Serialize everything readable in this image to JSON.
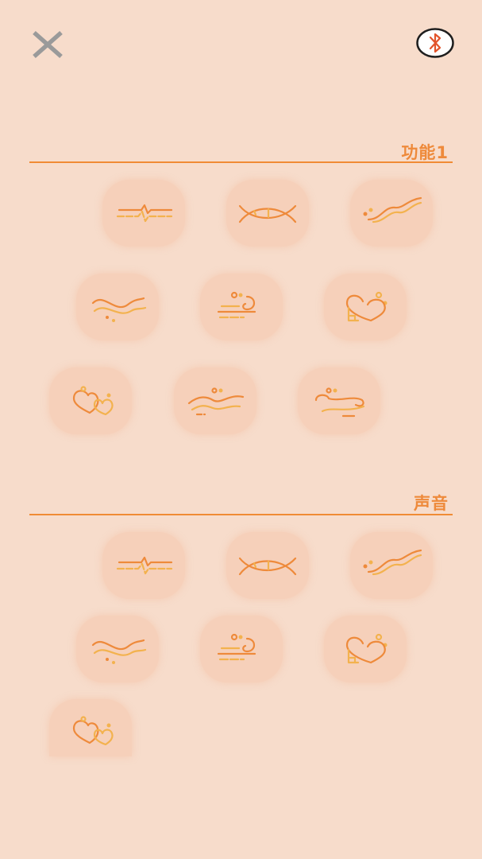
{
  "header": {
    "close_icon": "close-x-icon",
    "bluetooth_icon": "bluetooth-icon",
    "close_color": "#9a9a9a",
    "bluetooth_color": "#e2542b"
  },
  "sections": [
    {
      "title": "功能1",
      "modes": [
        {
          "icon": "pulse-line-icon"
        },
        {
          "icon": "crossed-waves-icon"
        },
        {
          "icon": "double-wave-icon"
        },
        {
          "icon": "ripple-waves-icon"
        },
        {
          "icon": "wind-swirl-icon"
        },
        {
          "icon": "cloud-heart-icon"
        },
        {
          "icon": "double-heart-icon"
        },
        {
          "icon": "mountain-waves-icon"
        },
        {
          "icon": "cloud-stream-icon"
        }
      ]
    },
    {
      "title": "声音",
      "modes": [
        {
          "icon": "pulse-line-icon"
        },
        {
          "icon": "crossed-waves-icon"
        },
        {
          "icon": "double-wave-icon"
        },
        {
          "icon": "ripple-waves-icon"
        },
        {
          "icon": "wind-swirl-icon"
        },
        {
          "icon": "cloud-heart-icon"
        },
        {
          "icon": "double-heart-icon"
        }
      ]
    }
  ],
  "colors": {
    "background": "#f7dccb",
    "accent": "#ee8a3b",
    "accent_light": "#f3b24e",
    "button_bg": "#f6d0ba"
  }
}
